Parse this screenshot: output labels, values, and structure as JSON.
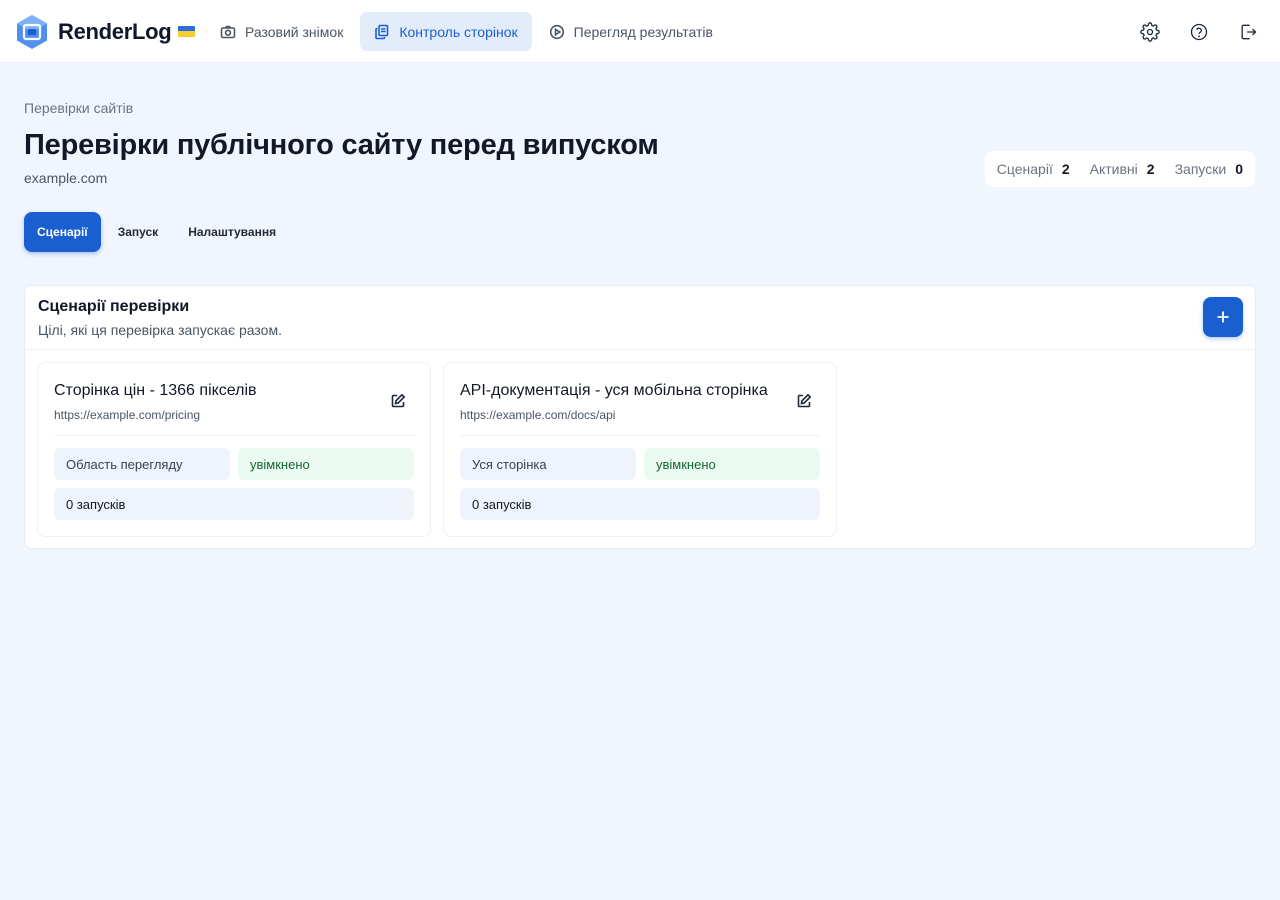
{
  "app": {
    "name": "RenderLog"
  },
  "nav": {
    "items": [
      {
        "label": "Разовий знімок",
        "icon": "camera-icon"
      },
      {
        "label": "Контроль сторінок",
        "icon": "copy-pages-icon",
        "active": true
      },
      {
        "label": "Перегляд результатів",
        "icon": "play-circle-icon"
      }
    ]
  },
  "top_icons": [
    "gear-icon",
    "help-icon",
    "logout-icon"
  ],
  "header": {
    "breadcrumb": "Перевірки сайтів",
    "title": "Перевірки публічного сайту перед випуском",
    "domain": "example.com"
  },
  "stats": [
    {
      "label": "Сценарії",
      "value": "2"
    },
    {
      "label": "Активні",
      "value": "2"
    },
    {
      "label": "Запуски",
      "value": "0"
    }
  ],
  "tabs": [
    {
      "label": "Сценарії",
      "active": true
    },
    {
      "label": "Запуск"
    },
    {
      "label": "Налаштування"
    }
  ],
  "panel": {
    "title": "Сценарії перевірки",
    "subtitle": "Цілі, які ця перевірка запускає разом."
  },
  "scenarios": [
    {
      "title": "Сторінка цін - 1366 пікселів",
      "url": "https://example.com/pricing",
      "mode": "Область перегляду",
      "status": "увімкнено",
      "runs": "0 запусків"
    },
    {
      "title": "API-документація - уся мобільна сторінка",
      "url": "https://example.com/docs/api",
      "mode": "Уся сторінка",
      "status": "увімкнено",
      "runs": "0 запусків"
    }
  ],
  "colors": {
    "accent": "#1a5fd0",
    "background": "#f0f5fe",
    "success_bg": "#ebfbf1",
    "success_text": "#166534"
  }
}
